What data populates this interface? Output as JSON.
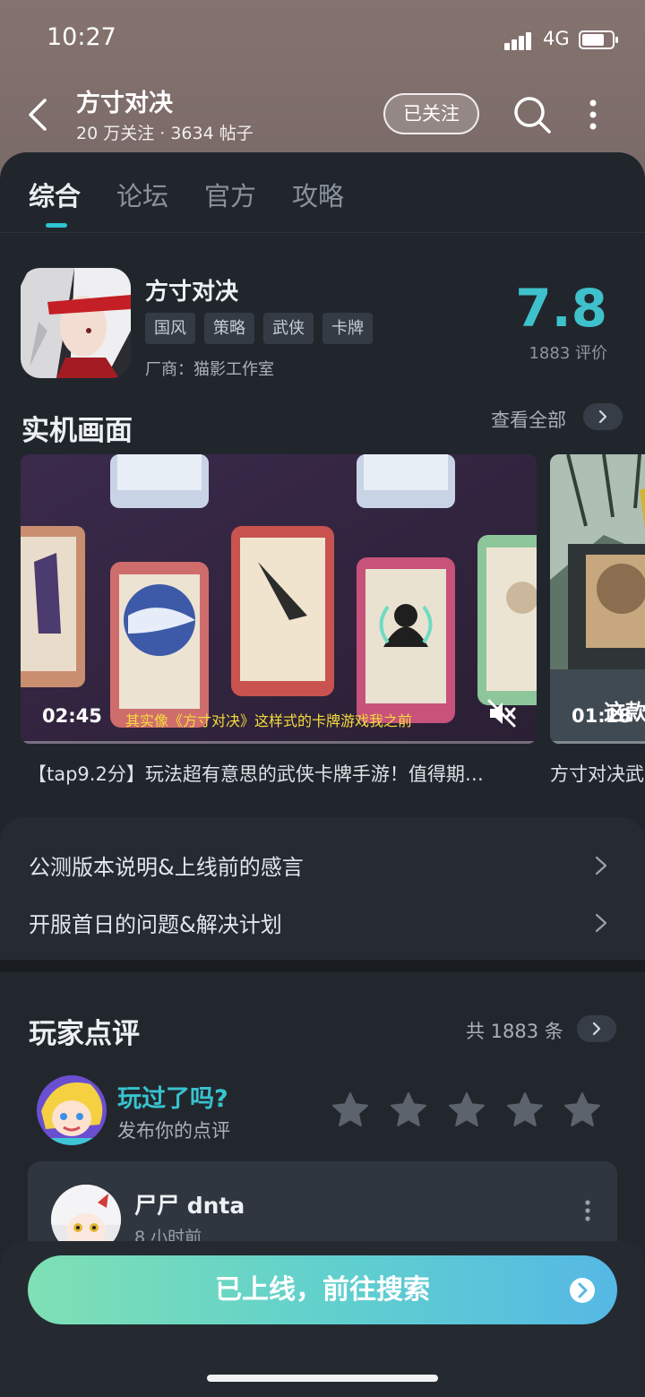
{
  "status_bar": {
    "time": "10:27",
    "network": "4G"
  },
  "header": {
    "title": "方寸对决",
    "subtitle": "20 万关注 · 3634 帖子",
    "follow_label": "已关注"
  },
  "tabs": [
    {
      "label": "综合",
      "active": true
    },
    {
      "label": "论坛",
      "active": false
    },
    {
      "label": "官方",
      "active": false
    },
    {
      "label": "攻略",
      "active": false
    }
  ],
  "game": {
    "name": "方寸对决",
    "tags": [
      "国风",
      "策略",
      "武侠",
      "卡牌"
    ],
    "vendor": "厂商：猫影工作室",
    "score": "7.8",
    "rating_count": "1883 评价"
  },
  "screenshots": {
    "title": "实机画面",
    "see_all": "查看全部",
    "videos": [
      {
        "duration": "02:45",
        "subtitle": "其实像《方寸对决》这样式的卡牌游戏我之前",
        "caption": "【tap9.2分】玩法超有意思的武侠卡牌手游！值得期…"
      },
      {
        "duration": "01:18",
        "subtitle": "这款",
        "caption": "方寸对决武"
      }
    ]
  },
  "announcements": [
    {
      "label": "公测版本说明&上线前的感言"
    },
    {
      "label": "开服首日的问题&解决计划"
    }
  ],
  "reviews": {
    "title": "玩家点评",
    "count": "共 1883 条",
    "prompt_title": "玩过了吗?",
    "prompt_sub": "发布你的点评",
    "stars": 5,
    "first_review": {
      "user": "尸尸 dnta",
      "time": "8 小时前"
    }
  },
  "cta": {
    "label": "已上线，前往搜索"
  },
  "colors": {
    "accent": "#3fc1cc",
    "panel": "#21262d",
    "header_bg": "#7d6f6c"
  }
}
